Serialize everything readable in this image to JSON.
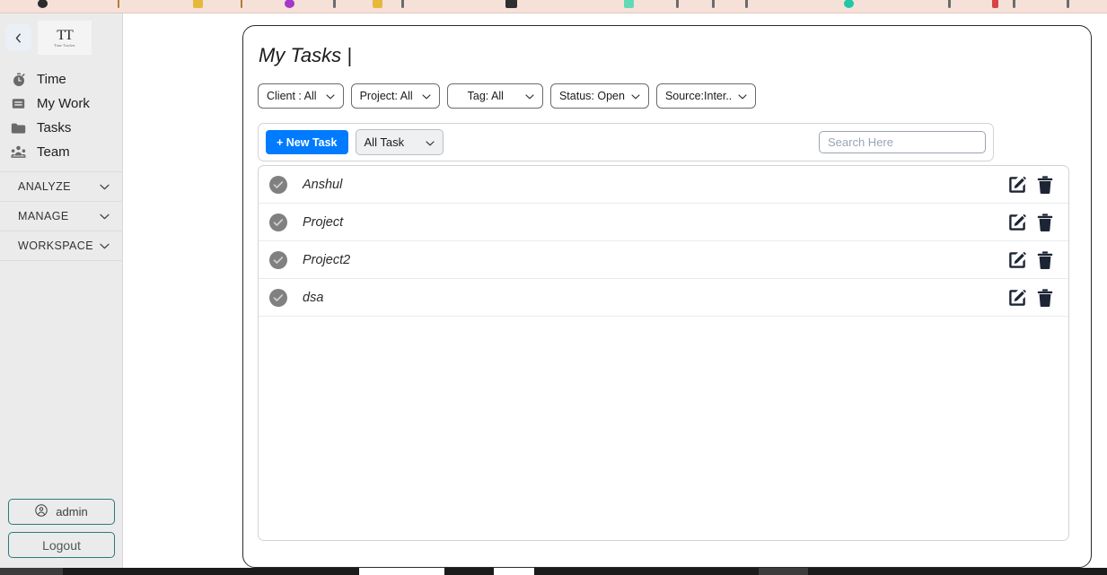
{
  "browser": {
    "bookmark_bar_visible": true,
    "bookmark_colors": [
      "#2c2c2c",
      "#cf8f3a",
      "#e0b23a",
      "#a537c9",
      "#e0b23a",
      "#333333",
      "#5fd6b0",
      "#2cc7a8",
      "#d64545",
      "#f0a63a",
      "#d64545"
    ]
  },
  "sidebar": {
    "collapse_icon": "chevron-left-icon",
    "logo": {
      "mark": "TT",
      "subtitle": "Time Tracker"
    },
    "items": [
      {
        "label": "Time",
        "icon": "stopwatch-icon"
      },
      {
        "label": "My Work",
        "icon": "list-card-icon"
      },
      {
        "label": "Tasks",
        "icon": "folder-icon"
      },
      {
        "label": "Team",
        "icon": "people-icon"
      }
    ],
    "sections": [
      {
        "label": "ANALYZE",
        "icon": "chevron-down-icon"
      },
      {
        "label": "MANAGE",
        "icon": "chevron-down-icon"
      },
      {
        "label": "WORKSPACE",
        "icon": "chevron-down-icon"
      }
    ],
    "account": {
      "user_label": "admin",
      "user_icon": "user-circle-icon",
      "logout_label": "Logout"
    },
    "accent_color": "#2b7b7b",
    "background_color": "#ebebeb"
  },
  "main": {
    "title": "My Tasks |",
    "filters": [
      {
        "label": "Client : All",
        "icon": "chevron-down-icon"
      },
      {
        "label": "Project: All",
        "icon": "chevron-down-icon"
      },
      {
        "label": "Tag: All",
        "icon": "chevron-down-icon"
      },
      {
        "label": "Status: Open",
        "icon": "chevron-down-icon"
      },
      {
        "label": "Source:Inter..",
        "icon": "chevron-down-icon"
      }
    ],
    "toolbar": {
      "new_task_label": "+ New Task",
      "new_task_color": "#007bff",
      "task_scope_label": "All Task",
      "task_scope_icon": "chevron-down-icon",
      "search_placeholder": "Search Here",
      "search_value": ""
    },
    "tasks": [
      {
        "name": "Anshul",
        "status_icon": "check-circle-icon",
        "edit_icon": "edit-pencil-icon",
        "delete_icon": "trash-icon"
      },
      {
        "name": "Project",
        "status_icon": "check-circle-icon",
        "edit_icon": "edit-pencil-icon",
        "delete_icon": "trash-icon"
      },
      {
        "name": "Project2",
        "status_icon": "check-circle-icon",
        "edit_icon": "edit-pencil-icon",
        "delete_icon": "trash-icon"
      },
      {
        "name": "dsa",
        "status_icon": "check-circle-icon",
        "edit_icon": "edit-pencil-icon",
        "delete_icon": "trash-icon"
      }
    ]
  }
}
